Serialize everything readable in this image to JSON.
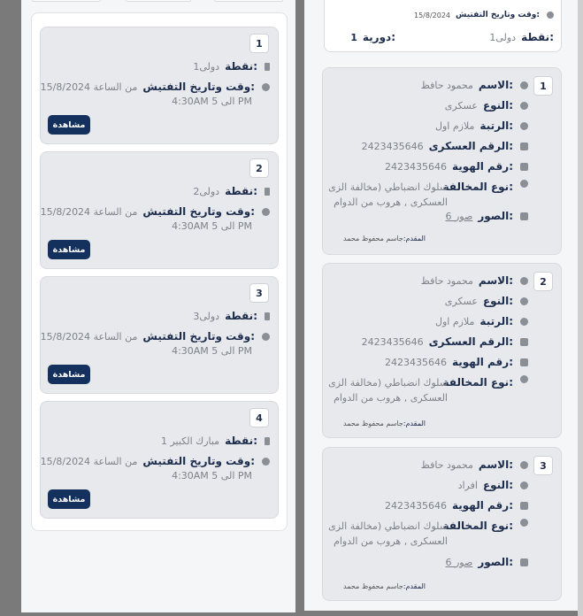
{
  "summary": {
    "date_label": "وقت وتاريخ التفتيش:",
    "date_value": "15/8/2024",
    "point_label": "نقطة:",
    "point_value": "دولى1",
    "patrol_label": "دورية:",
    "patrol_value": "1"
  },
  "labels": {
    "point": "نقطة:",
    "datetime": "وقت وتاريخ التفتيش:",
    "view": "مشاهدة",
    "name": "الاسم:",
    "type": "النوع:",
    "rank": "الرتبة:",
    "military_no": "الرقم العسكرى:",
    "id_no": "رقم الهوية:",
    "violation": "نوع المخالفة:",
    "photos": "الصور:",
    "provider": "المقدم:"
  },
  "inspections": [
    {
      "num": "1",
      "point": "دولى1",
      "date_line1": "15/8/2024 من الساعة",
      "date_line2": "4:30AM الى 5 PM"
    },
    {
      "num": "2",
      "point": "دولى2",
      "date_line1": "15/8/2024 من الساعة",
      "date_line2": "4:30AM الى 5 PM"
    },
    {
      "num": "3",
      "point": "دولى3",
      "date_line1": "15/8/2024 من الساعة",
      "date_line2": "4:30AM الى 5 PM"
    },
    {
      "num": "4",
      "point": "مبارك الكبير 1",
      "date_line1": "15/8/2024 من الساعة",
      "date_line2": "4:30AM الى 5 PM"
    }
  ],
  "violations": [
    {
      "num": "1",
      "name": "محمود  حافظ",
      "type": "عسكرى",
      "rank": "ملازم اول",
      "military_no": "2423435646",
      "id_no": "2423435646",
      "violation": "سلوك انضباطي (مخالفة الزى العسكرى ,  هروب من  الدوام",
      "photos": "6 صور",
      "provider": "جاسم محفوظ محمد"
    },
    {
      "num": "2",
      "name": "محمود  حافظ",
      "type": "عسكرى",
      "rank": "ملازم اول",
      "military_no": "2423435646",
      "id_no": "2423435646",
      "violation": "سلوك انضباطي (مخالفة الزى العسكرى ,  هروب من  الدوام",
      "provider": "جاسم محفوظ محمد"
    },
    {
      "num": "3",
      "name": "محمود  حافظ",
      "type": "افراد",
      "id_no": "2423435646",
      "violation": "سلوك انضباطي (مخالفة الزى العسكرى ,  هروب من  الدوام",
      "photos": "6 صور",
      "provider": "جاسم محفوظ محمد"
    }
  ],
  "colors": {
    "navy": "#14305c",
    "card": "#e7e9ec",
    "backdrop": "#7a7a7a"
  }
}
